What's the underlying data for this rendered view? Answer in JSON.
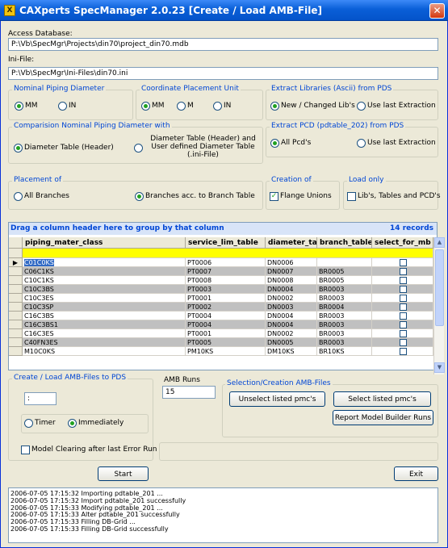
{
  "title": "CAXperts SpecManager 2.0.23 [Create / Load AMB-File]",
  "app_icon": "X",
  "close_glyph": "✕",
  "access_db": {
    "label": "Access Database:",
    "value": "P:\\Vb\\SpecMgr\\Projects\\din70\\project_din70.mdb"
  },
  "ini_file": {
    "label": "Ini-File:",
    "value": "P:\\Vb\\SpecMgr\\Ini-Files\\din70.ini"
  },
  "nominal_piping": {
    "title": "Nominal Piping Diameter",
    "options": [
      "MM",
      "IN"
    ],
    "selected": 0
  },
  "coord_unit": {
    "title": "Coordinate Placement Unit",
    "options": [
      "MM",
      "M",
      "IN"
    ],
    "selected": 0
  },
  "extract_libs": {
    "title": "Extract Libraries (Ascii) from PDS",
    "options": [
      "New / Changed Lib's",
      "Use last Extraction"
    ],
    "selected": 0
  },
  "comparison": {
    "title": "Comparision Nominal Piping Diameter with",
    "opt1": "Diameter Table (Header)",
    "opt2_line1": "Diameter Table (Header) and",
    "opt2_line2": "User defined Diameter Table",
    "opt2_line3": "(.ini-File)",
    "selected": 0
  },
  "extract_pcd": {
    "title": "Extract PCD (pdtable_202) from PDS",
    "options": [
      "All Pcd's",
      "Use last Extraction"
    ],
    "selected": 0
  },
  "placement": {
    "title": "Placement of",
    "options": [
      "All Branches",
      "Branches acc. to Branch Table"
    ],
    "selected": 1
  },
  "creation": {
    "title": "Creation of",
    "checkbox": "Flange Unions",
    "checked": true
  },
  "load_only": {
    "title": "Load only",
    "checkbox": "Lib's, Tables and PCD's",
    "checked": false
  },
  "grid": {
    "group_hint": "Drag a column header here to group by that column",
    "record_count": "14 records",
    "columns": [
      "piping_mater_class",
      "service_lim_table",
      "diameter_table",
      "branch_table",
      "select_for_mb"
    ],
    "rows": [
      [
        "C01C0KS",
        "PT0006",
        "DN0006",
        "",
        false
      ],
      [
        "C06C1KS",
        "PT0007",
        "DN0007",
        "BR0005",
        false
      ],
      [
        "C10C1KS",
        "PT0008",
        "DN0008",
        "BR0005",
        false
      ],
      [
        "C10C3BS",
        "PT0003",
        "DN0004",
        "BR0003",
        false
      ],
      [
        "C10C3ES",
        "PT0001",
        "DN0002",
        "BR0003",
        false
      ],
      [
        "C10C3SP",
        "PT0002",
        "DN0003",
        "BR0004",
        false
      ],
      [
        "C16C3BS",
        "PT0004",
        "DN0004",
        "BR0003",
        false
      ],
      [
        "C16C3BS1",
        "PT0004",
        "DN0004",
        "BR0003",
        false
      ],
      [
        "C16C3ES",
        "PT0001",
        "DN0002",
        "BR0003",
        false
      ],
      [
        "C40FN3ES",
        "PT0005",
        "DN0005",
        "BR0003",
        false
      ],
      [
        "M10C0KS",
        "PM10KS",
        "DM10KS",
        "BR10KS",
        false
      ]
    ]
  },
  "create_load": {
    "title": "Create / Load AMB-Files to PDS",
    "time_value": ":",
    "options": [
      "Timer",
      "Immediately"
    ],
    "selected": 1,
    "model_clearing": "Model Clearing after last Error Run"
  },
  "amb_runs": {
    "title": "AMB Runs",
    "value": "15"
  },
  "selection": {
    "title": "Selection/Creation AMB-Files",
    "unselect": "Unselect listed pmc's",
    "select": "Select listed pmc's",
    "report": "Report Model Builder Runs"
  },
  "start_label": "Start",
  "exit_label": "Exit",
  "log": [
    "2006-07-05 17:15:32  Importing pdtable_201 ...",
    "2006-07-05 17:15:32  Import pdtable_201 successfully",
    "2006-07-05 17:15:33  Modifying pdtable_201 ...",
    "2006-07-05 17:15:33  Alter pdtable_201 successfully",
    "2006-07-05 17:15:33  Filling DB-Grid ...",
    "2006-07-05 17:15:33  Filling DB-Grid successfully"
  ],
  "colors": {
    "accent": "#0046d5",
    "title_bar": "#0a5fd8",
    "window": "#ece9d8",
    "row_alt": "#c0c0c0",
    "new_row": "#ffff00"
  }
}
